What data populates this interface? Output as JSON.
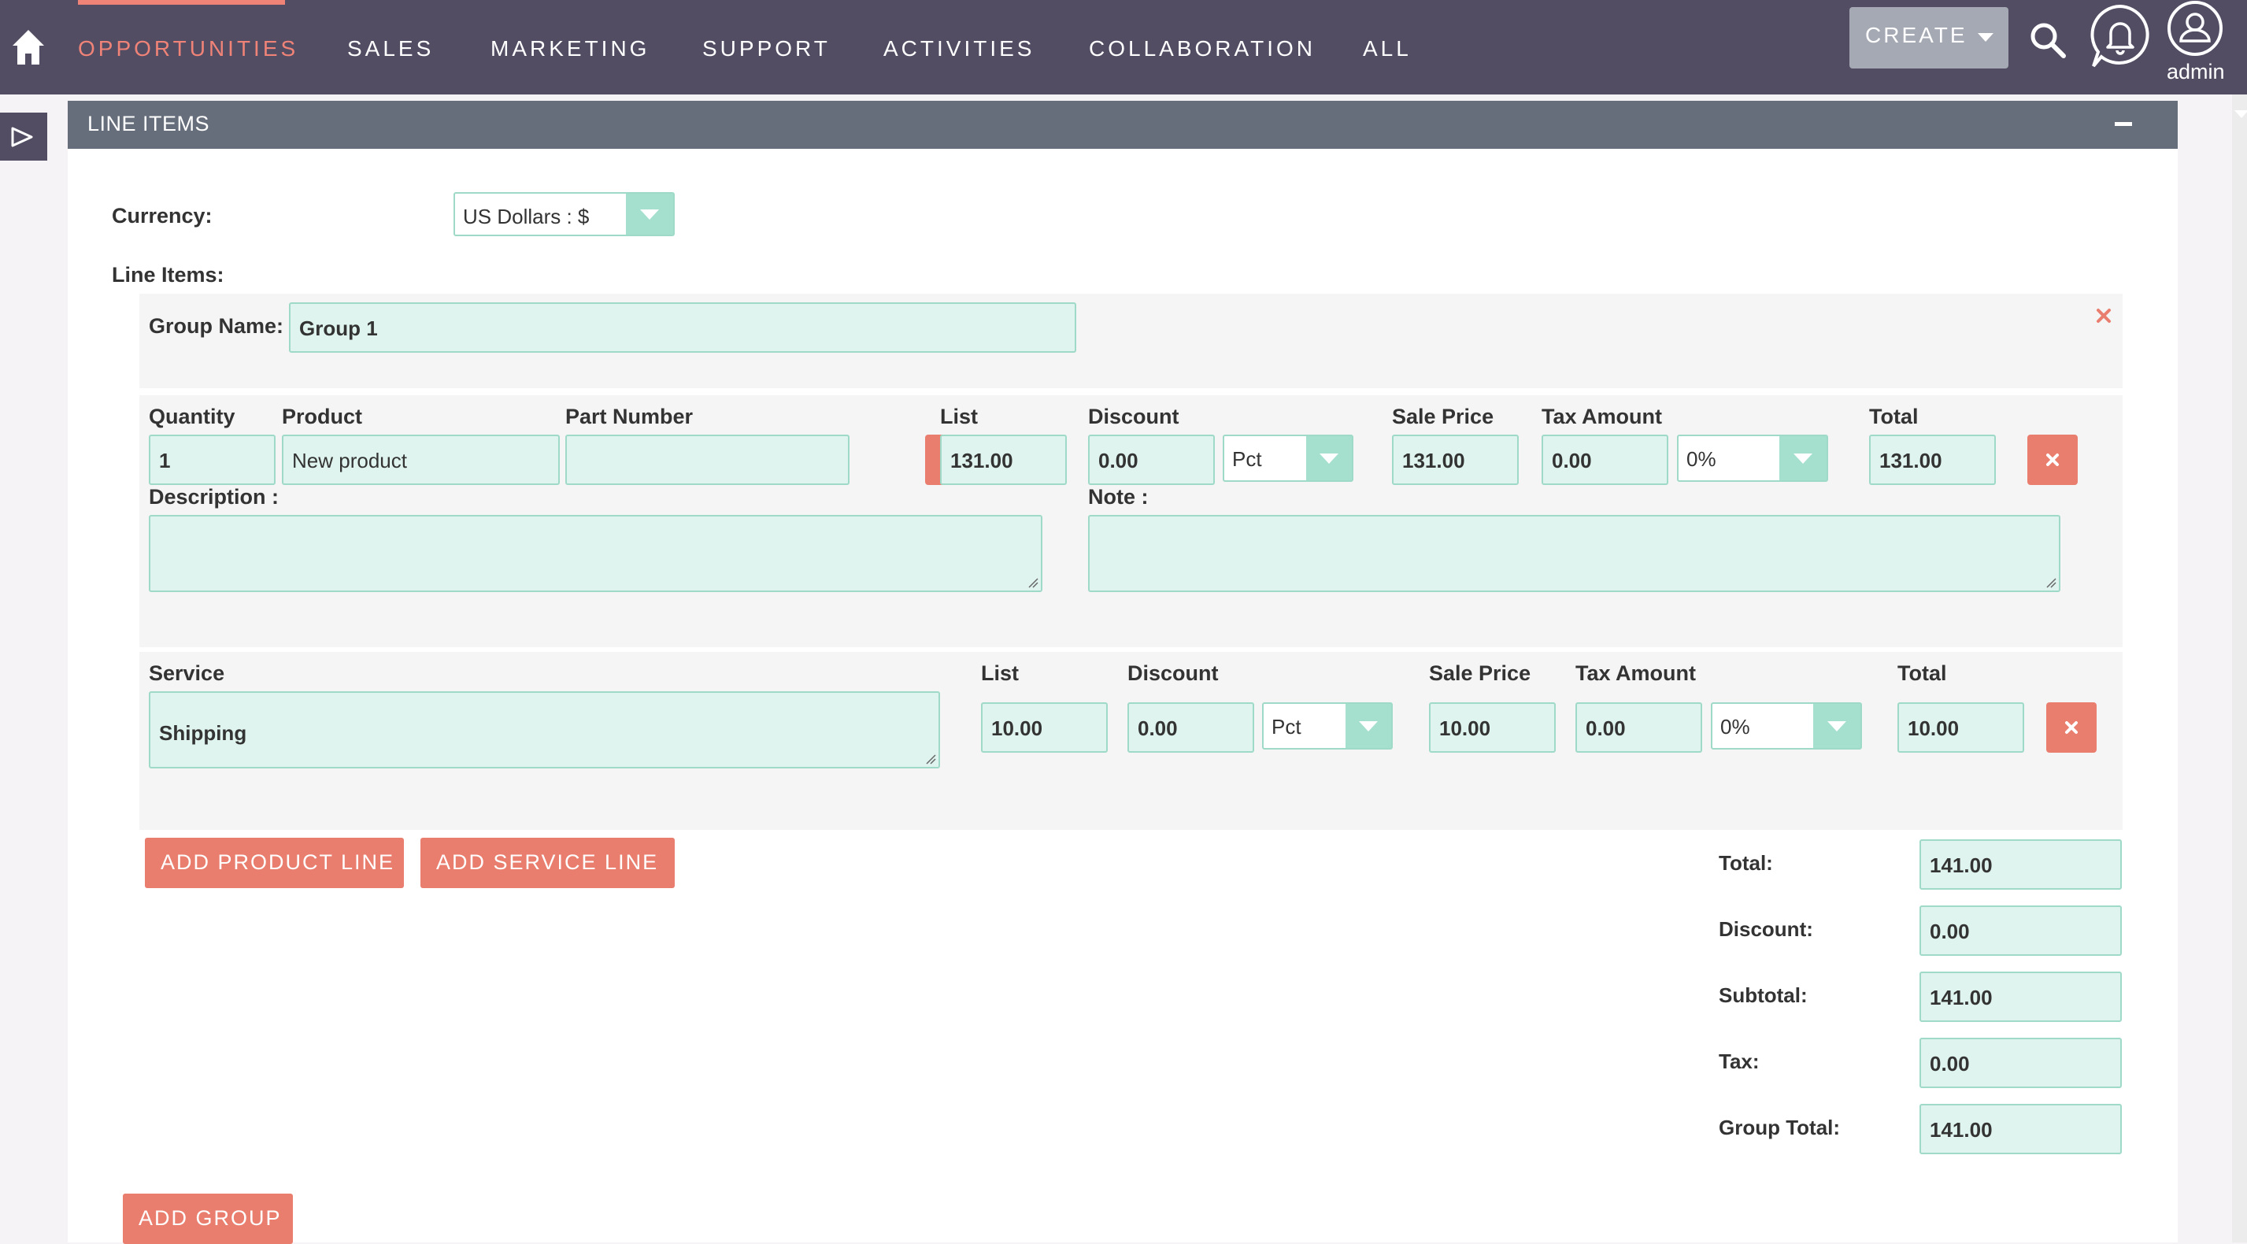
{
  "nav": {
    "items": [
      "OPPORTUNITIES",
      "SALES",
      "MARKETING",
      "SUPPORT",
      "ACTIVITIES",
      "COLLABORATION",
      "ALL"
    ],
    "create_label": "CREATE",
    "user_label": "admin"
  },
  "panel": {
    "title": "LINE ITEMS"
  },
  "currency": {
    "label": "Currency:",
    "value": "US Dollars : $"
  },
  "line_items_label": "Line Items:",
  "group": {
    "name_label": "Group Name:",
    "name_value": "Group 1"
  },
  "product_line": {
    "headers": {
      "quantity": "Quantity",
      "product": "Product",
      "part_number": "Part Number",
      "list": "List",
      "discount": "Discount",
      "sale_price": "Sale Price",
      "tax_amount": "Tax Amount",
      "total": "Total",
      "description": "Description :",
      "note": "Note :"
    },
    "quantity": "1",
    "product": "New product",
    "part_number": "",
    "list": "131.00",
    "discount": "0.00",
    "discount_type": "Pct",
    "sale_price": "131.00",
    "tax_amount": "0.00",
    "tax_rate": "0%",
    "total": "131.00",
    "description": "",
    "note": ""
  },
  "service_line": {
    "headers": {
      "service": "Service",
      "list": "List",
      "discount": "Discount",
      "sale_price": "Sale Price",
      "tax_amount": "Tax Amount",
      "total": "Total"
    },
    "service": "Shipping",
    "list": "10.00",
    "discount": "0.00",
    "discount_type": "Pct",
    "sale_price": "10.00",
    "tax_amount": "0.00",
    "tax_rate": "0%",
    "total": "10.00"
  },
  "buttons": {
    "add_product_line": "ADD PRODUCT LINE",
    "add_service_line": "ADD SERVICE LINE",
    "add_group": "ADD GROUP"
  },
  "totals": {
    "total_label": "Total:",
    "total": "141.00",
    "discount_label": "Discount:",
    "discount": "0.00",
    "subtotal_label": "Subtotal:",
    "subtotal": "141.00",
    "tax_label": "Tax:",
    "tax": "0.00",
    "group_total_label": "Group Total:",
    "group_total": "141.00"
  },
  "colors": {
    "nav_bg": "#534d64",
    "accent": "#f08377",
    "field_bg": "#dff4ee",
    "field_border": "#9fd9c7",
    "button": "#e97e6f"
  }
}
